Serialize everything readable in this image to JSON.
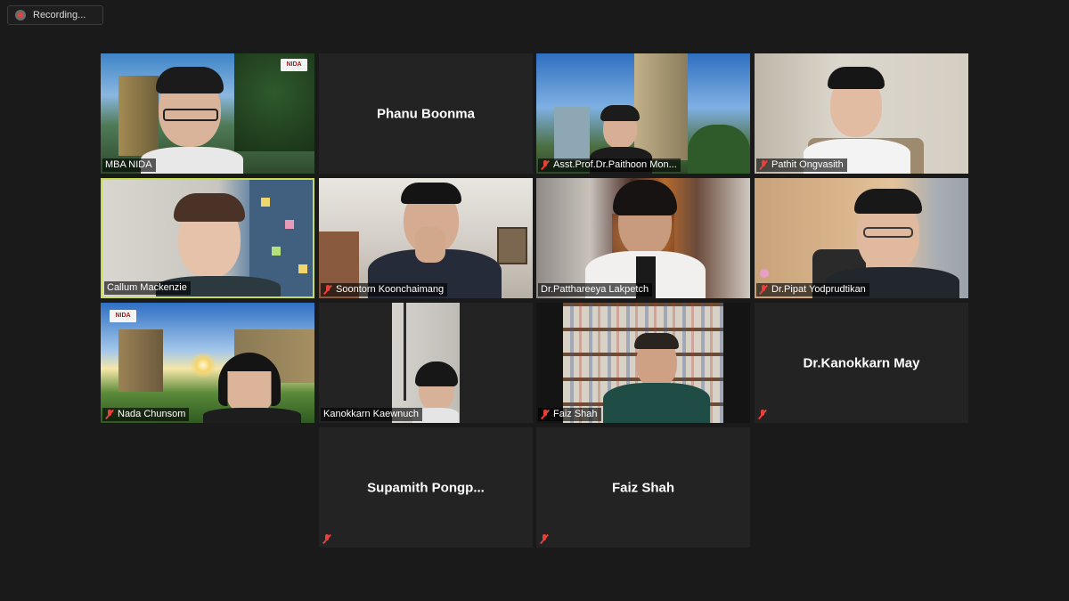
{
  "recording": {
    "label": "Recording..."
  },
  "participants": [
    {
      "name": "MBA NIDA",
      "muted": false,
      "video": true
    },
    {
      "name": "Phanu Boonma",
      "muted": false,
      "video": false
    },
    {
      "name": "Asst.Prof.Dr.Paithoon Mon...",
      "muted": true,
      "video": true
    },
    {
      "name": "Pathit Ongvasith",
      "muted": true,
      "video": true
    },
    {
      "name": "Callum Mackenzie",
      "muted": false,
      "video": true,
      "active_speaker": true
    },
    {
      "name": "Soontorn Koonchaimang",
      "muted": true,
      "video": true
    },
    {
      "name": "Dr.Patthareeya Lakpetch",
      "muted": false,
      "video": true
    },
    {
      "name": "Dr.Pipat Yodprudtikan",
      "muted": true,
      "video": true
    },
    {
      "name": "Nada Chunsom",
      "muted": true,
      "video": true
    },
    {
      "name": "Kanokkarn Kaewnuch",
      "muted": false,
      "video": true
    },
    {
      "name": "Faiz Shah",
      "muted": true,
      "video": true
    },
    {
      "name": "Dr.Kanokkarn May",
      "muted": true,
      "video": false
    },
    {
      "name": "Supamith  Pongp...",
      "muted": true,
      "video": false
    },
    {
      "name": "Faiz Shah",
      "muted": true,
      "video": false
    }
  ],
  "logos": {
    "nida_top": "NIDA",
    "nida_bottom": "NIDA"
  },
  "colors": {
    "background": "#1a1a1a",
    "tile": "#232323",
    "active_border": "#c7dd52",
    "muted_icon": "#e8403a"
  }
}
